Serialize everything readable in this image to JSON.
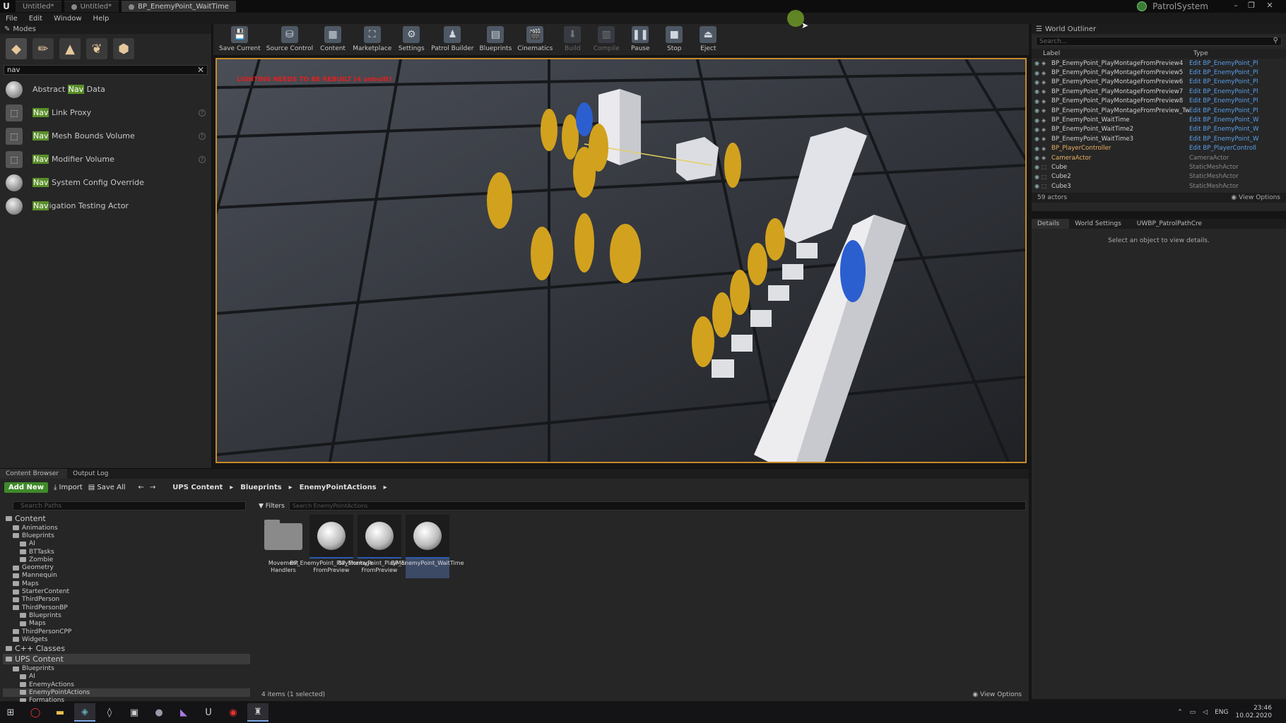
{
  "titlebar": {
    "tabs": [
      "Untitled*",
      "Untitled*",
      "BP_EnemyPoint_WaitTime"
    ],
    "project": "PatrolSystem"
  },
  "menu": [
    "File",
    "Edit",
    "Window",
    "Help"
  ],
  "modes": {
    "title": "Modes",
    "search": "nav",
    "items": [
      {
        "pre": "Abstract ",
        "hl": "Nav",
        "post": " Data"
      },
      {
        "pre": "",
        "hl": "Nav",
        "post": " Link Proxy"
      },
      {
        "pre": "",
        "hl": "Nav",
        "post": " Mesh Bounds Volume"
      },
      {
        "pre": "",
        "hl": "Nav",
        "post": " Modifier Volume"
      },
      {
        "pre": "",
        "hl": "Nav",
        "post": " System Config Override"
      },
      {
        "pre": "",
        "hl": "Nav",
        "post": "igation Testing Actor"
      }
    ]
  },
  "toolbar": [
    "Save Current",
    "Source Control",
    "Content",
    "Marketplace",
    "Settings",
    "Patrol Builder",
    "Blueprints",
    "Cinematics",
    "Build",
    "Compile",
    "Pause",
    "Stop",
    "Eject"
  ],
  "viewport": {
    "warning": "LIGHTING NEEDS TO BE REBUILT (4 unbuilt)"
  },
  "outliner": {
    "title": "World Outliner",
    "search_placeholder": "Search...",
    "col_label": "Label",
    "col_type": "Type",
    "rows": [
      {
        "label": "BP_EnemyPoint_PlayMontageFromPreview4",
        "type": "Edit BP_EnemyPoint_Pl"
      },
      {
        "label": "BP_EnemyPoint_PlayMontageFromPreview5",
        "type": "Edit BP_EnemyPoint_Pl"
      },
      {
        "label": "BP_EnemyPoint_PlayMontageFromPreview6",
        "type": "Edit BP_EnemyPoint_Pl"
      },
      {
        "label": "BP_EnemyPoint_PlayMontageFromPreview7",
        "type": "Edit BP_EnemyPoint_Pl"
      },
      {
        "label": "BP_EnemyPoint_PlayMontageFromPreview8",
        "type": "Edit BP_EnemyPoint_Pl"
      },
      {
        "label": "BP_EnemyPoint_PlayMontageFromPreview_TwoCh",
        "type": "Edit BP_EnemyPoint_Pl"
      },
      {
        "label": "BP_EnemyPoint_WaitTime",
        "type": "Edit BP_EnemyPoint_W"
      },
      {
        "label": "BP_EnemyPoint_WaitTime2",
        "type": "Edit BP_EnemyPoint_W"
      },
      {
        "label": "BP_EnemyPoint_WaitTime3",
        "type": "Edit BP_EnemyPoint_W"
      },
      {
        "label": "BP_PlayerController",
        "type": "Edit BP_PlayerControll"
      },
      {
        "label": "CameraActor",
        "type": "CameraActor"
      },
      {
        "label": "Cube",
        "type": "StaticMeshActor"
      },
      {
        "label": "Cube2",
        "type": "StaticMeshActor"
      },
      {
        "label": "Cube3",
        "type": "StaticMeshActor"
      }
    ],
    "count": "59 actors",
    "view_options": "View Options"
  },
  "details": {
    "tabs": [
      "Details",
      "World Settings",
      "UWBP_PatrolPathCre"
    ],
    "message": "Select an object to view details."
  },
  "content_browser": {
    "tabs": [
      "Content Browser",
      "Output Log"
    ],
    "add_new": "Add New",
    "import": "Import",
    "save_all": "Save All",
    "breadcrumb": [
      "UPS Content",
      "Blueprints",
      "EnemyPointActions"
    ],
    "search_paths": "Search Paths",
    "filters": "Filters",
    "search_assets": "Search EnemyPointActions",
    "tree": [
      {
        "t": "Content",
        "d": 0,
        "big": true
      },
      {
        "t": "Animations",
        "d": 1
      },
      {
        "t": "Blueprints",
        "d": 1
      },
      {
        "t": "AI",
        "d": 2
      },
      {
        "t": "BTTasks",
        "d": 2
      },
      {
        "t": "Zombie",
        "d": 2
      },
      {
        "t": "Geometry",
        "d": 1
      },
      {
        "t": "Mannequin",
        "d": 1
      },
      {
        "t": "Maps",
        "d": 1
      },
      {
        "t": "StarterContent",
        "d": 1
      },
      {
        "t": "ThirdPerson",
        "d": 1
      },
      {
        "t": "ThirdPersonBP",
        "d": 1
      },
      {
        "t": "Blueprints",
        "d": 2
      },
      {
        "t": "Maps",
        "d": 2
      },
      {
        "t": "ThirdPersonCPP",
        "d": 1
      },
      {
        "t": "Widgets",
        "d": 1
      },
      {
        "t": "C++ Classes",
        "d": 0,
        "big": true
      },
      {
        "t": "UPS Content",
        "d": 0,
        "big": true,
        "sel": true
      },
      {
        "t": "Blueprints",
        "d": 1
      },
      {
        "t": "AI",
        "d": 2
      },
      {
        "t": "EnemyActions",
        "d": 2
      },
      {
        "t": "EnemyPointActions",
        "d": 2,
        "sel": true
      },
      {
        "t": "Formations",
        "d": 2
      }
    ],
    "assets": [
      {
        "name": "Movement Handlers",
        "kind": "folder"
      },
      {
        "name": "BP_EnemyPoint_PlayMontage FromPreview",
        "kind": "bp"
      },
      {
        "name": "BP_EnemyPoint_PlayMontage FromPreview",
        "kind": "bp"
      },
      {
        "name": "BP_EnemyPoint_WaitTime",
        "kind": "bp",
        "selected": true
      }
    ],
    "status": "4 items (1 selected)",
    "view_options": "View Options"
  },
  "taskbar": {
    "lang": "ENG",
    "time": "23:46",
    "date": "10.02.2020"
  }
}
